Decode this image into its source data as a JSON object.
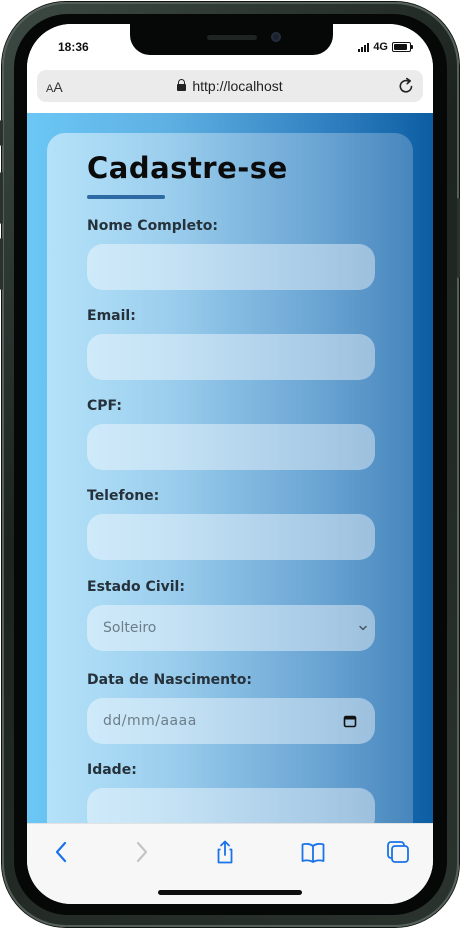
{
  "status_bar": {
    "time": "18:36",
    "network": "4G"
  },
  "address_bar": {
    "text_size_small": "A",
    "text_size_large": "A",
    "url": "http://localhost"
  },
  "form": {
    "title": "Cadastre-se",
    "fields": [
      {
        "label": "Nome Completo:",
        "value": ""
      },
      {
        "label": "Email:",
        "value": ""
      },
      {
        "label": "CPF:",
        "value": ""
      },
      {
        "label": "Telefone:",
        "value": ""
      },
      {
        "label": "Estado Civil:",
        "selected": "Solteiro"
      },
      {
        "label": "Data de Nascimento:",
        "placeholder": "dd/mm/aaaa"
      },
      {
        "label": "Idade:",
        "value": ""
      }
    ]
  },
  "icons": {
    "back": "chevron-left-icon",
    "forward": "chevron-right-icon",
    "share": "share-icon",
    "bookmarks": "book-icon",
    "tabs": "tabs-icon",
    "reload": "reload-icon",
    "lock": "lock-icon",
    "calendar": "calendar-icon"
  },
  "colors": {
    "accent": "#1a73e8",
    "title_underline": "#2d6aa4",
    "background_left": "#6bc7f5",
    "background_right": "#0c5da3"
  }
}
